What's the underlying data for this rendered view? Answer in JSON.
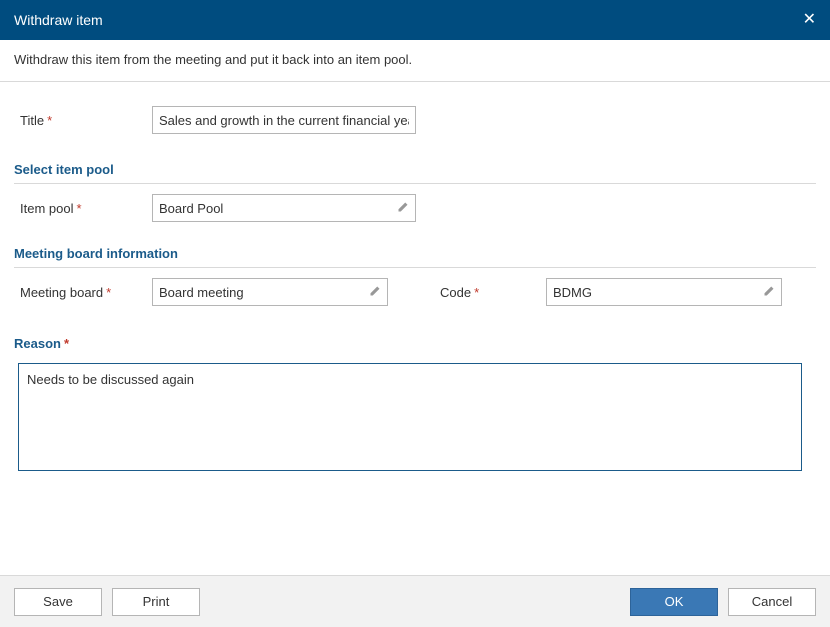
{
  "header": {
    "title": "Withdraw item",
    "close": "✕"
  },
  "instruction": "Withdraw this item from the meeting and put it back into an item pool.",
  "fields": {
    "title_label": "Title",
    "title_value": "Sales and growth in the current financial year",
    "item_pool_label": "Item pool",
    "item_pool_value": "Board Pool",
    "meeting_board_label": "Meeting board",
    "meeting_board_value": "Board meeting",
    "code_label": "Code",
    "code_value": "BDMG"
  },
  "sections": {
    "select_pool": "Select item pool",
    "meeting_info": "Meeting board information",
    "reason": "Reason"
  },
  "reason_value": "Needs to be discussed again",
  "footer": {
    "save": "Save",
    "print": "Print",
    "ok": "OK",
    "cancel": "Cancel"
  }
}
